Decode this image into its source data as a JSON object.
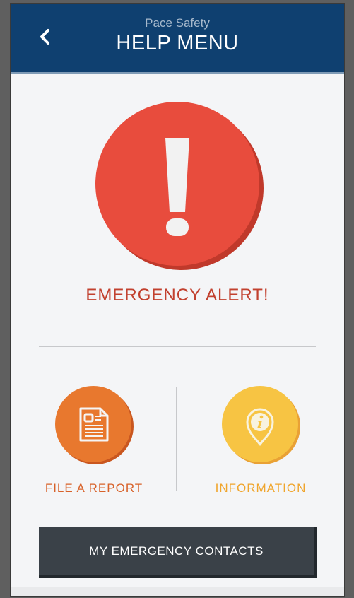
{
  "header": {
    "subtitle": "Pace Safety",
    "title": "HELP MENU",
    "back_icon": "chevron-left-icon"
  },
  "alert": {
    "label": "EMERGENCY ALERT!",
    "icon": "exclamation-icon",
    "color": "#e84c3d"
  },
  "options": [
    {
      "label": "FILE A REPORT",
      "icon": "document-icon",
      "color": "#e8782e"
    },
    {
      "label": "INFORMATION",
      "icon": "info-pin-icon",
      "color": "#f7c443"
    }
  ],
  "contacts_button": {
    "label": "MY EMERGENCY CONTACTS"
  },
  "colors": {
    "header_bg": "#0f4070",
    "background": "#f4f5f7",
    "contacts_bg": "#3a4148"
  }
}
